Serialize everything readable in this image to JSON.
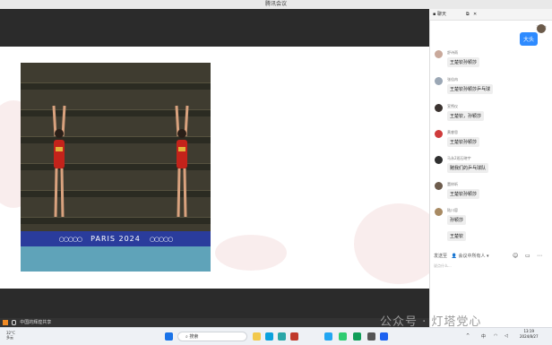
{
  "window": {
    "title": "腾讯会议"
  },
  "video": {
    "banner_text": "PARIS 2024"
  },
  "share_bar": {
    "label": "中国的辉煌共享"
  },
  "chat": {
    "title": "聊天",
    "self": {
      "name": "王桂花",
      "message": "大头"
    },
    "messages": [
      {
        "sender": "舒诗雨",
        "text": "王楚钦孙颖莎"
      },
      {
        "sender": "张佳冉",
        "text": "王楚钦孙颖莎乒乓球"
      },
      {
        "sender": "宣煦仪",
        "text": "王楚钦，孙颖莎"
      },
      {
        "sender": "黄睿思",
        "text": "王楚钦孙颖莎"
      },
      {
        "sender": "马永2班石晓宇",
        "text": "赌我们的乒乓球队"
      },
      {
        "sender": "董梓昕",
        "text": "王楚钦孙颖莎"
      },
      {
        "sender": "陆川容",
        "text": "孙颖莎"
      },
      {
        "sender": "",
        "text": "王楚钦"
      }
    ],
    "send_to_label": "发送至",
    "send_to_value": "会议中所有人",
    "input_placeholder": "说点什么..."
  },
  "taskbar": {
    "weather_temp": "32°C",
    "weather_desc": "多云",
    "search_placeholder": "搜索",
    "lang": "中",
    "time": "13:19",
    "date": "2024/8/27"
  },
  "watermark": "公众号 · 灯塔党心",
  "colors": {
    "accent": "#2e8bff",
    "olympic_banner": "#2a3c9c",
    "pool": "#5fa3b9"
  }
}
